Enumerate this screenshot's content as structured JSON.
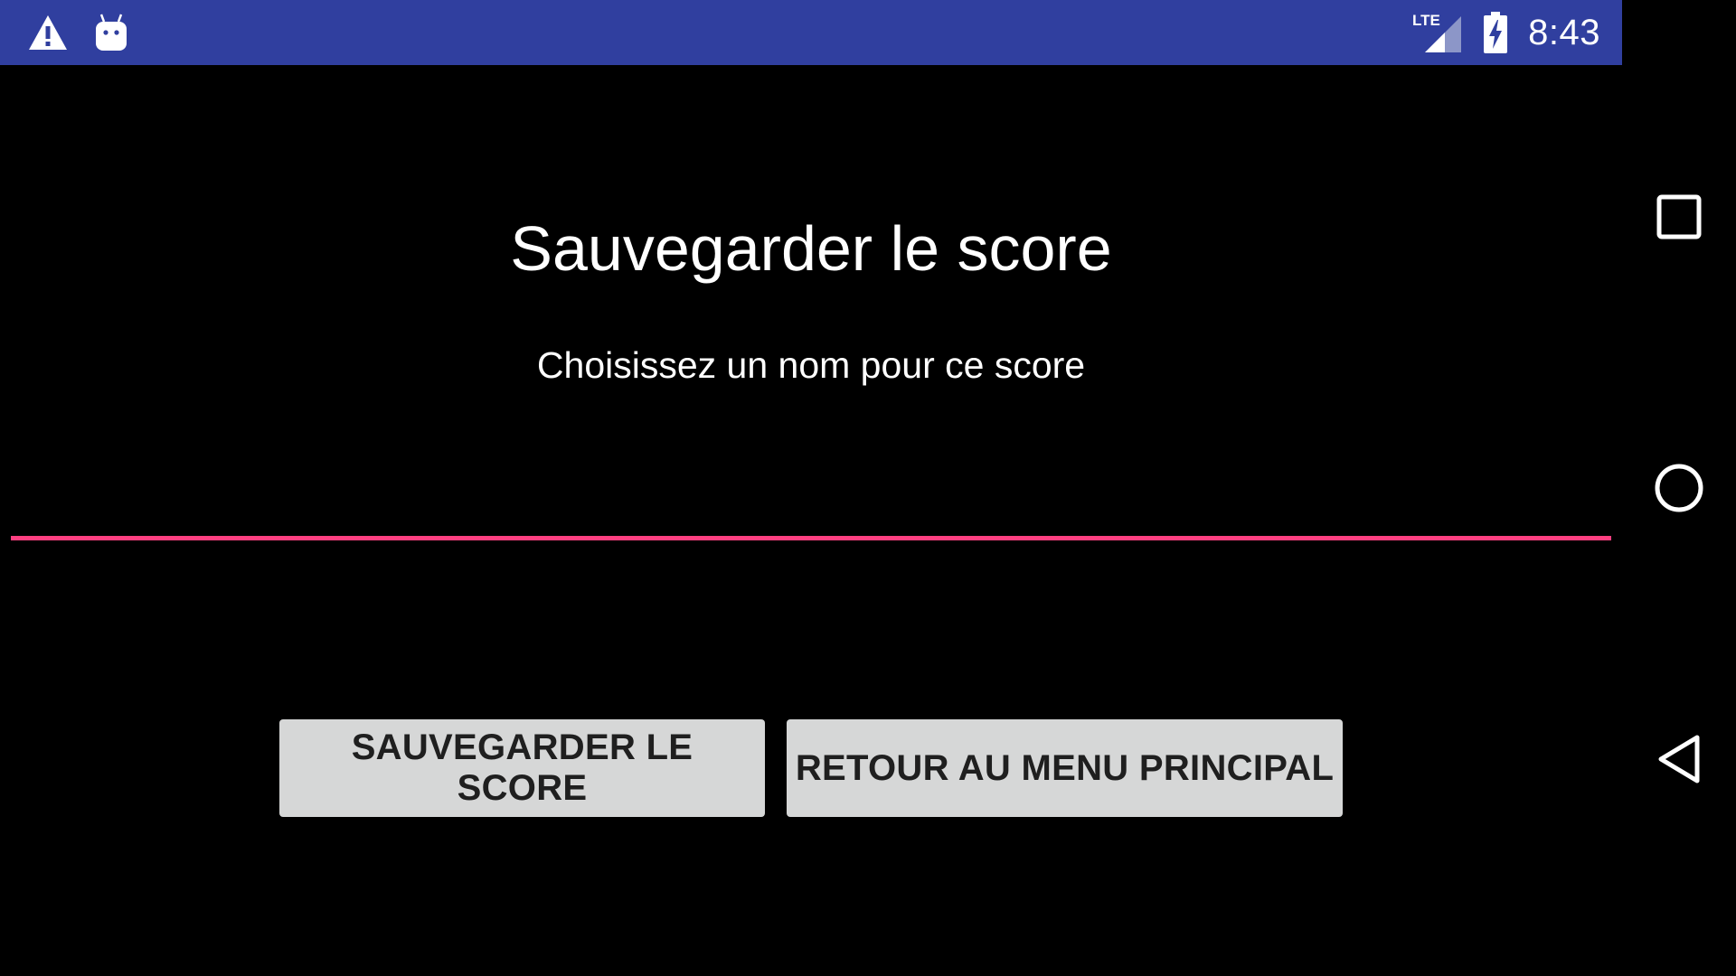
{
  "status_bar": {
    "background": "#303f9f",
    "left_icons": [
      "warning-icon",
      "android-debug-icon"
    ],
    "network_label": "LTE",
    "right_icons": [
      "lte-signal-icon",
      "battery-charging-icon"
    ],
    "time": "8:43"
  },
  "main": {
    "title": "Sauvegarder le score",
    "subtitle": "Choisissez un nom pour ce score",
    "name_input": {
      "value": "",
      "underline_color": "#ff4081"
    },
    "buttons": {
      "save_label": "SAUVEGARDER LE SCORE",
      "menu_label": "RETOUR AU MENU PRINCIPAL"
    }
  },
  "nav_bar": {
    "items": [
      "recents-icon",
      "home-icon",
      "back-icon"
    ]
  }
}
